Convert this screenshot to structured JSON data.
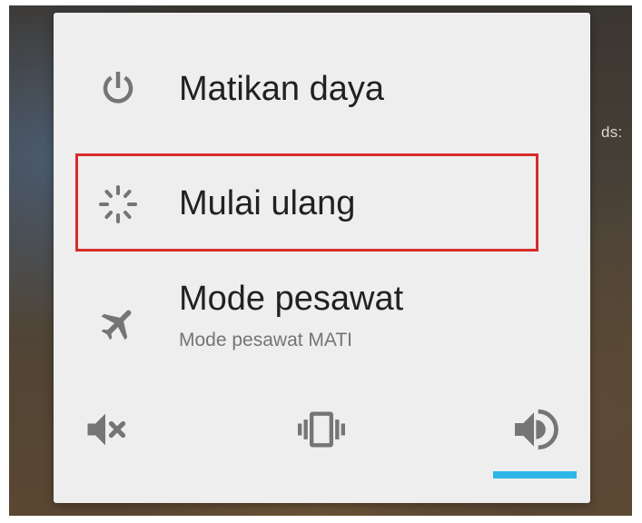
{
  "background": {
    "partial_text": "ds:"
  },
  "power_menu": {
    "items": [
      {
        "label": "Matikan daya",
        "icon": "power-icon"
      },
      {
        "label": "Mulai ulang",
        "icon": "restart-spinner-icon"
      },
      {
        "label": "Mode pesawat",
        "sublabel": "Mode pesawat MATI",
        "icon": "airplane-icon"
      }
    ],
    "sound_modes": [
      {
        "icon": "mute-icon",
        "selected": false
      },
      {
        "icon": "vibrate-icon",
        "selected": false
      },
      {
        "icon": "volume-icon",
        "selected": true
      }
    ]
  },
  "colors": {
    "dialog_bg": "#eeeeee",
    "icon": "#757575",
    "text": "#212121",
    "highlight": "#d92b2b",
    "accent": "#2fb6e8"
  }
}
